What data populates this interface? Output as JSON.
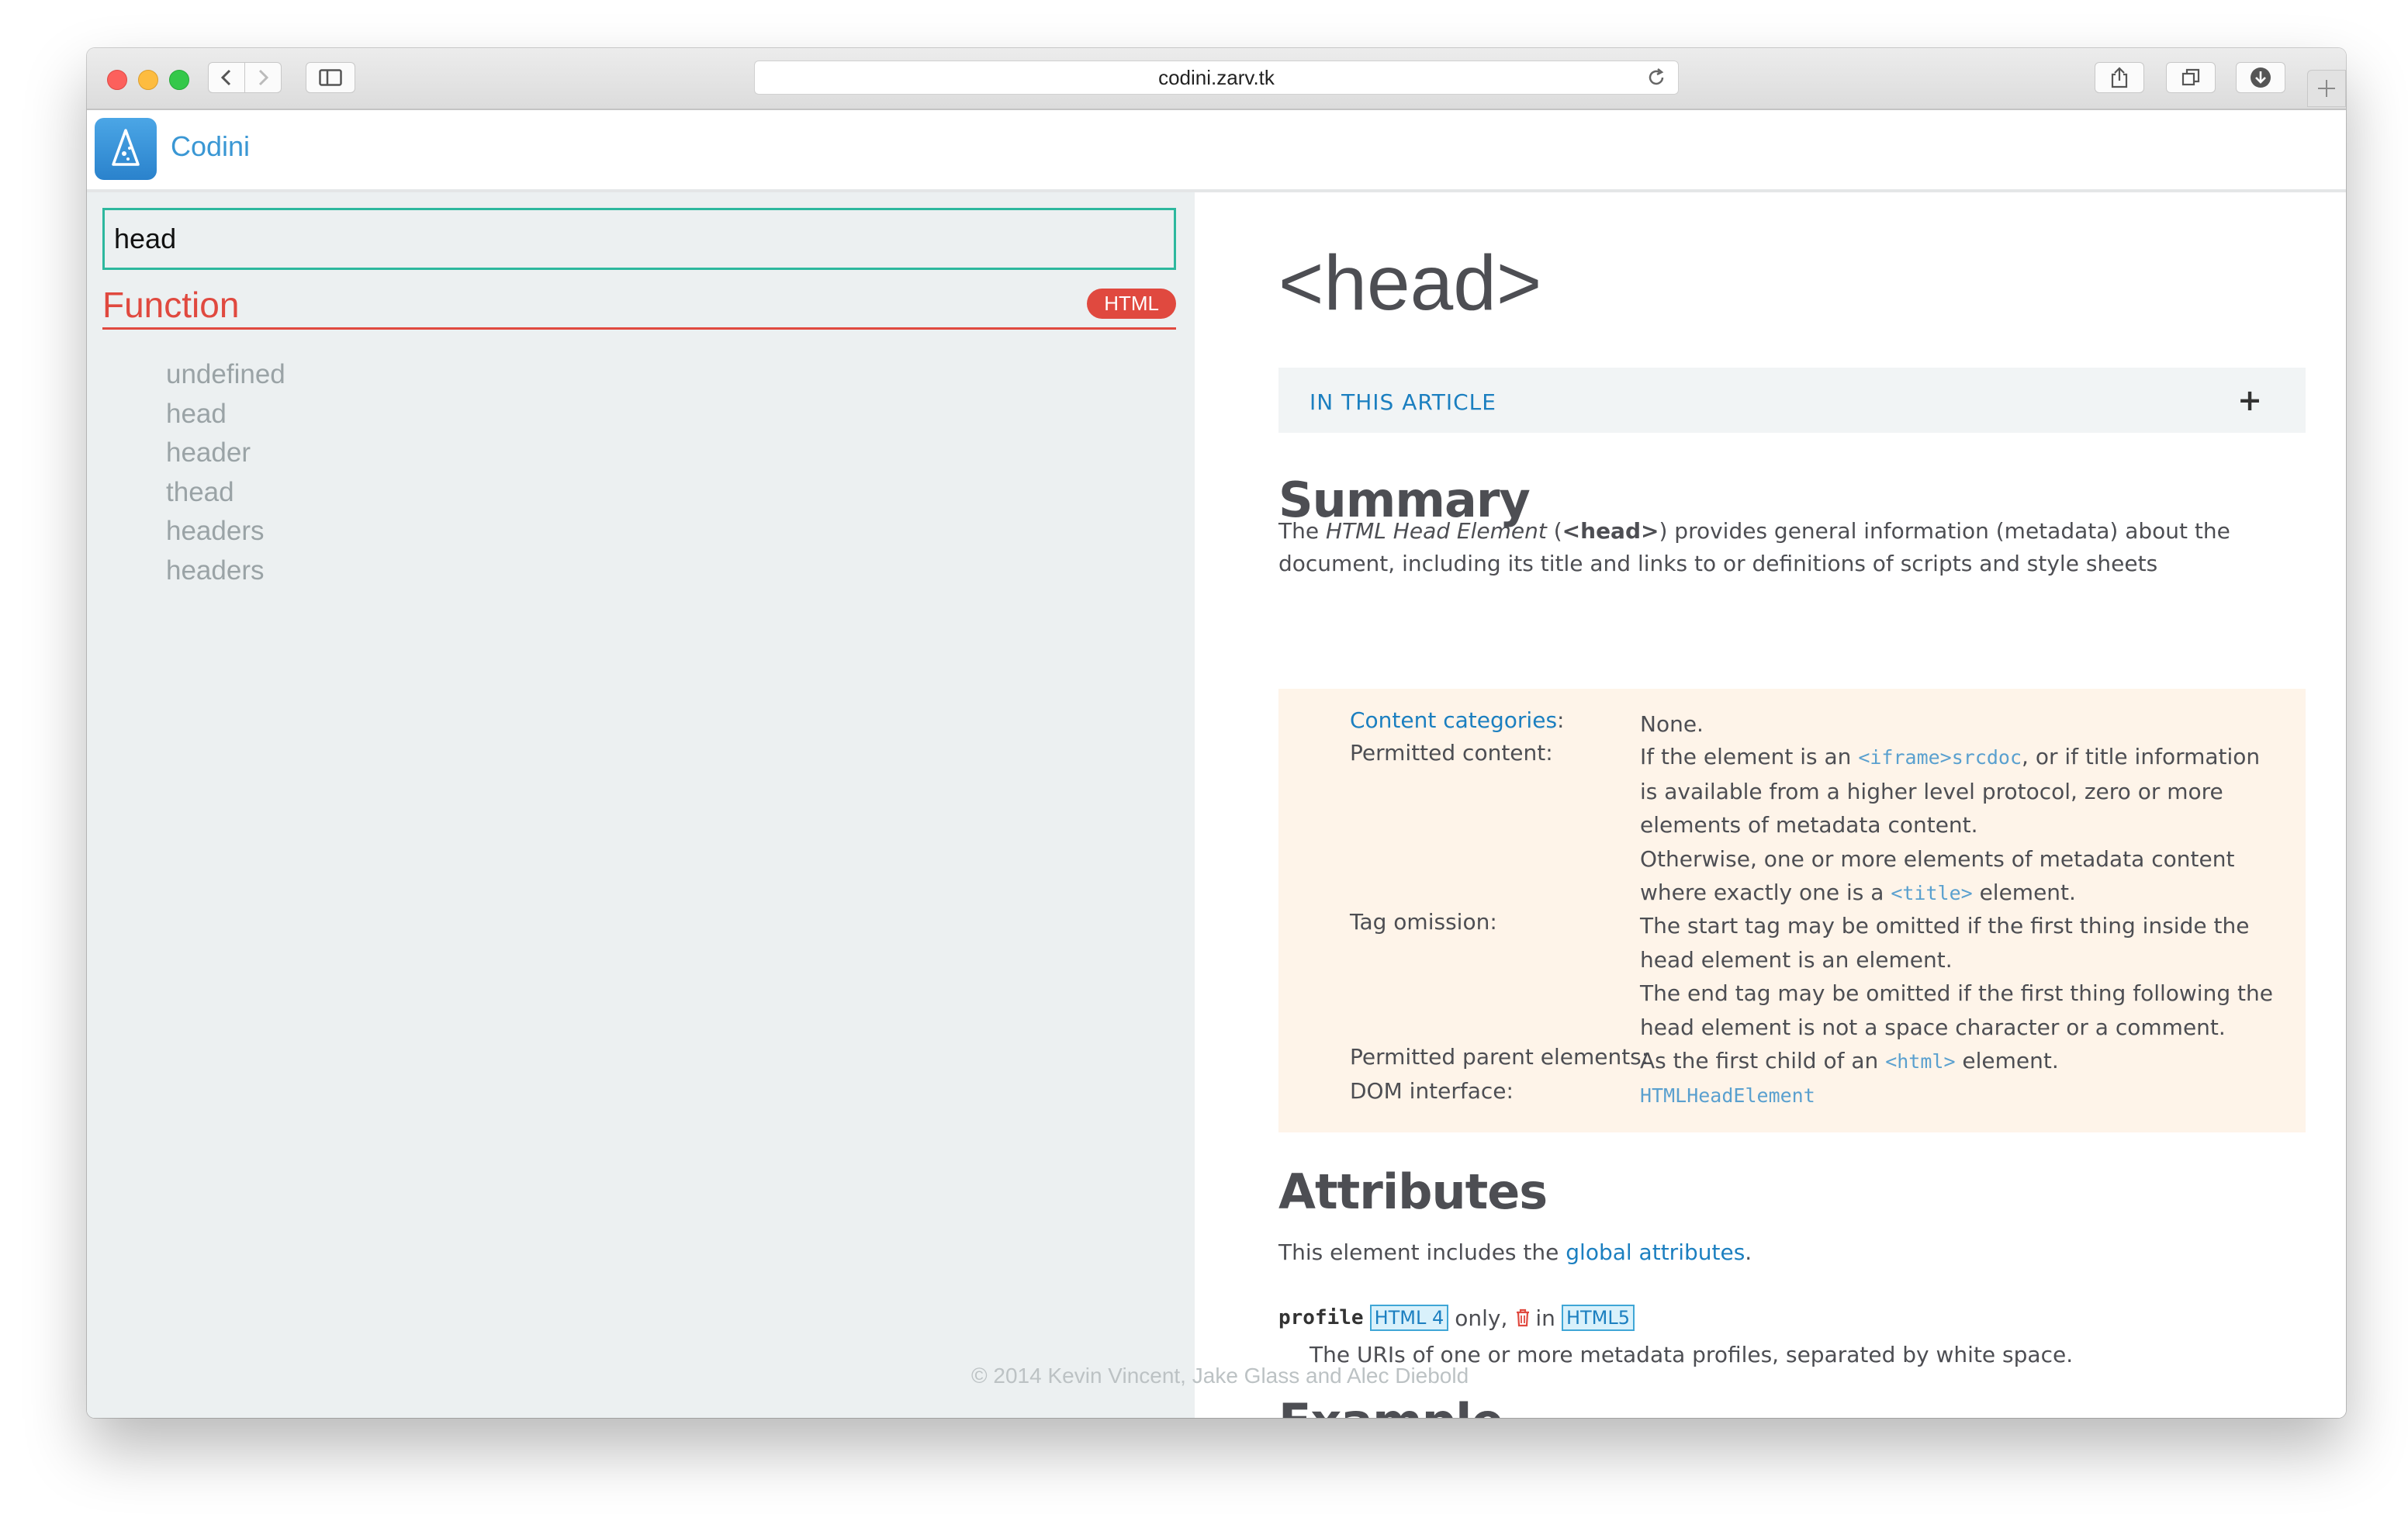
{
  "browser": {
    "url": "codini.zarv.tk"
  },
  "app": {
    "brand": "Codini",
    "search_value": "head",
    "category": "Function",
    "category_badge": "HTML",
    "results": [
      "undefined",
      "head",
      "header",
      "thead",
      "headers",
      "headers"
    ],
    "footer": "© 2014 Kevin Vincent, Jake Glass and Alec Diebold"
  },
  "article": {
    "title": "<head>",
    "toc_label": "IN THIS ARTICLE",
    "toc_toggle": "+",
    "summary_heading": "Summary",
    "summary": {
      "pre": "The ",
      "em": "HTML Head Element",
      "mid1": " (",
      "strong": "<head>",
      "post": ") provides general information (metadata) about the document, including its title and links to or definitions of scripts and style sheets"
    },
    "props": {
      "content_categories_label": "Content categories",
      "content_categories_colon": ":",
      "content_categories_value": "None.",
      "permitted_content_label": "Permitted content:",
      "pc_1a": "If the element is an ",
      "pc_1code": "<iframe>srcdoc",
      "pc_1b": ", or if title information is available from a higher level protocol, zero or more elements of metadata content.",
      "pc_2a": "Otherwise, one or more elements of metadata content where exactly one is a ",
      "pc_2code": "<title>",
      "pc_2b": " element.",
      "tag_omission_label": "Tag omission:",
      "to_1": "The start tag may be omitted if the first thing inside the head element is an element.",
      "to_2": "The end tag may be omitted if the first thing following the head element is not a space character or a comment.",
      "parent_label": "Permitted parent elements:",
      "parent_a": "As the first child of an ",
      "parent_code": "<html>",
      "parent_b": " element.",
      "dom_label": "DOM interface:",
      "dom_value": "HTMLHeadElement"
    },
    "attributes_heading": "Attributes",
    "attributes_text_pre": "This element includes the ",
    "attributes_link": "global attributes",
    "attributes_text_post": ".",
    "attr_name": "profile",
    "attr_tag1": "HTML 4",
    "attr_only": " only,",
    "attr_in": " in ",
    "attr_tag2": "HTML5",
    "attr_desc": "The URIs of one or more metadata profiles, separated by white space.",
    "example_heading": "Example"
  },
  "colors": {
    "accent_red": "#e0493f",
    "link_blue": "#1b7fc0",
    "search_border": "#2db89e",
    "panel_bg": "#ecf0f1",
    "props_bg": "#fef4e9"
  }
}
